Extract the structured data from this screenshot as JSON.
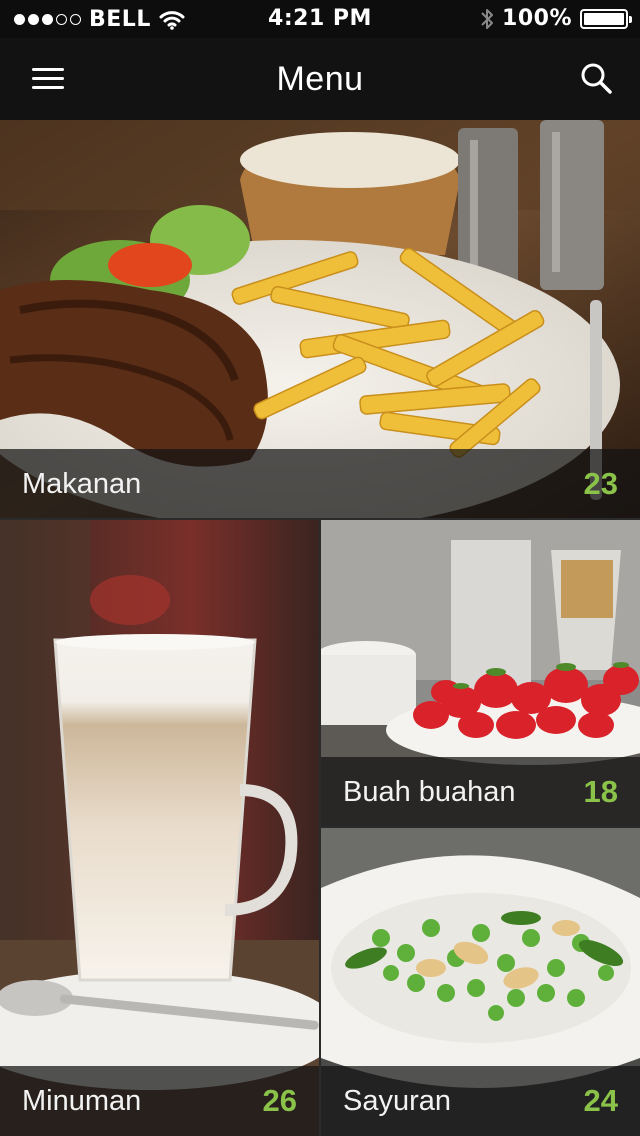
{
  "status_bar": {
    "carrier": "BELL",
    "time": "4:21 PM",
    "battery": "100%",
    "battery_level": 1.0,
    "signal_bars_filled": 3,
    "signal_bars_total": 5
  },
  "nav": {
    "title": "Menu",
    "menu_icon": "hamburger-icon",
    "search_icon": "search-icon"
  },
  "categories": [
    {
      "label": "Makanan",
      "count": "23"
    },
    {
      "label": "Minuman",
      "count": "26"
    },
    {
      "label": "Buah buahan",
      "count": "18"
    },
    {
      "label": "Sayuran",
      "count": "24"
    }
  ],
  "colors": {
    "accent": "#8bc34a",
    "nav_background": "#121212",
    "caption_background": "#141414"
  }
}
